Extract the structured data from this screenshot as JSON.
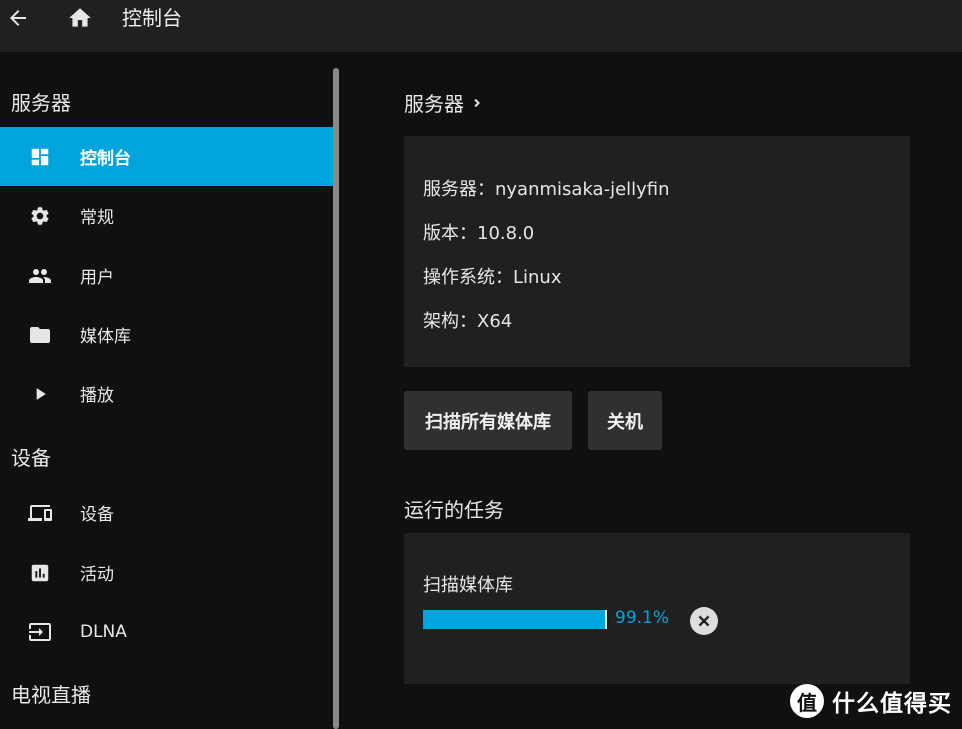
{
  "header": {
    "title": "控制台",
    "back_icon": "arrow-back-icon",
    "home_icon": "home-icon"
  },
  "sidebar": {
    "sections": [
      {
        "title": "服务器",
        "items": [
          {
            "label": "控制台",
            "icon": "dashboard-icon",
            "active": true
          },
          {
            "label": "常规",
            "icon": "gear-icon"
          },
          {
            "label": "用户",
            "icon": "people-icon"
          },
          {
            "label": "媒体库",
            "icon": "folder-icon"
          },
          {
            "label": "播放",
            "icon": "play-icon"
          }
        ]
      },
      {
        "title": "设备",
        "items": [
          {
            "label": "设备",
            "icon": "devices-icon"
          },
          {
            "label": "活动",
            "icon": "chart-icon"
          },
          {
            "label": "DLNA",
            "icon": "input-icon"
          }
        ]
      },
      {
        "title": "电视直播",
        "items": []
      }
    ]
  },
  "main": {
    "server_title": "服务器",
    "server_info": {
      "server": "服务器：nyanmisaka-jellyfin",
      "version": "版本：10.8.0",
      "os": "操作系统：Linux",
      "arch": "架构：X64"
    },
    "buttons": {
      "scan_all": "扫描所有媒体库",
      "shutdown": "关机"
    },
    "tasks_title": "运行的任务",
    "task": {
      "name": "扫描媒体库",
      "progress": 99.1,
      "progress_text": "99.1%"
    }
  },
  "colors": {
    "accent": "#00a4dc",
    "background": "#101010",
    "card": "#202020"
  },
  "watermark": {
    "logo_char": "值",
    "text": "什么值得买"
  }
}
